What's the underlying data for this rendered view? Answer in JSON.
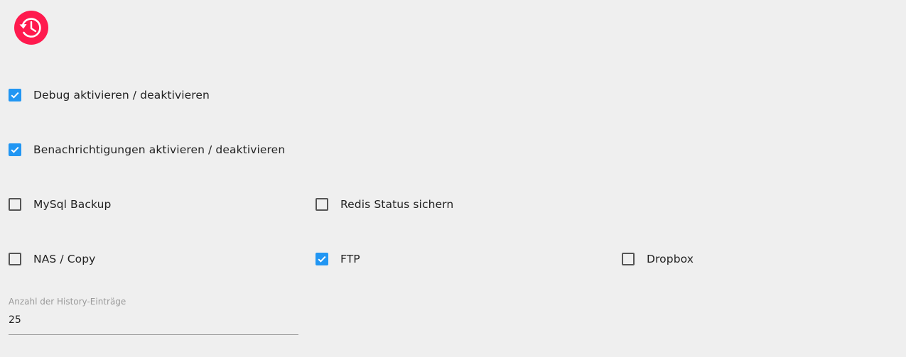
{
  "app": {
    "accent_color": "#ff1a4e",
    "checkbox_color": "#2196f3"
  },
  "options": {
    "debug": {
      "label": "Debug aktivieren / deaktivieren",
      "checked": true
    },
    "notifications": {
      "label": "Benachrichtigungen aktivieren / deaktivieren",
      "checked": true
    },
    "mysql_backup": {
      "label": "MySql Backup",
      "checked": false
    },
    "redis_backup": {
      "label": "Redis Status sichern",
      "checked": false
    },
    "nas_copy": {
      "label": "NAS / Copy",
      "checked": false
    },
    "ftp": {
      "label": "FTP",
      "checked": true
    },
    "dropbox": {
      "label": "Dropbox",
      "checked": false
    }
  },
  "history": {
    "label": "Anzahl der History-Einträge",
    "value": "25"
  }
}
